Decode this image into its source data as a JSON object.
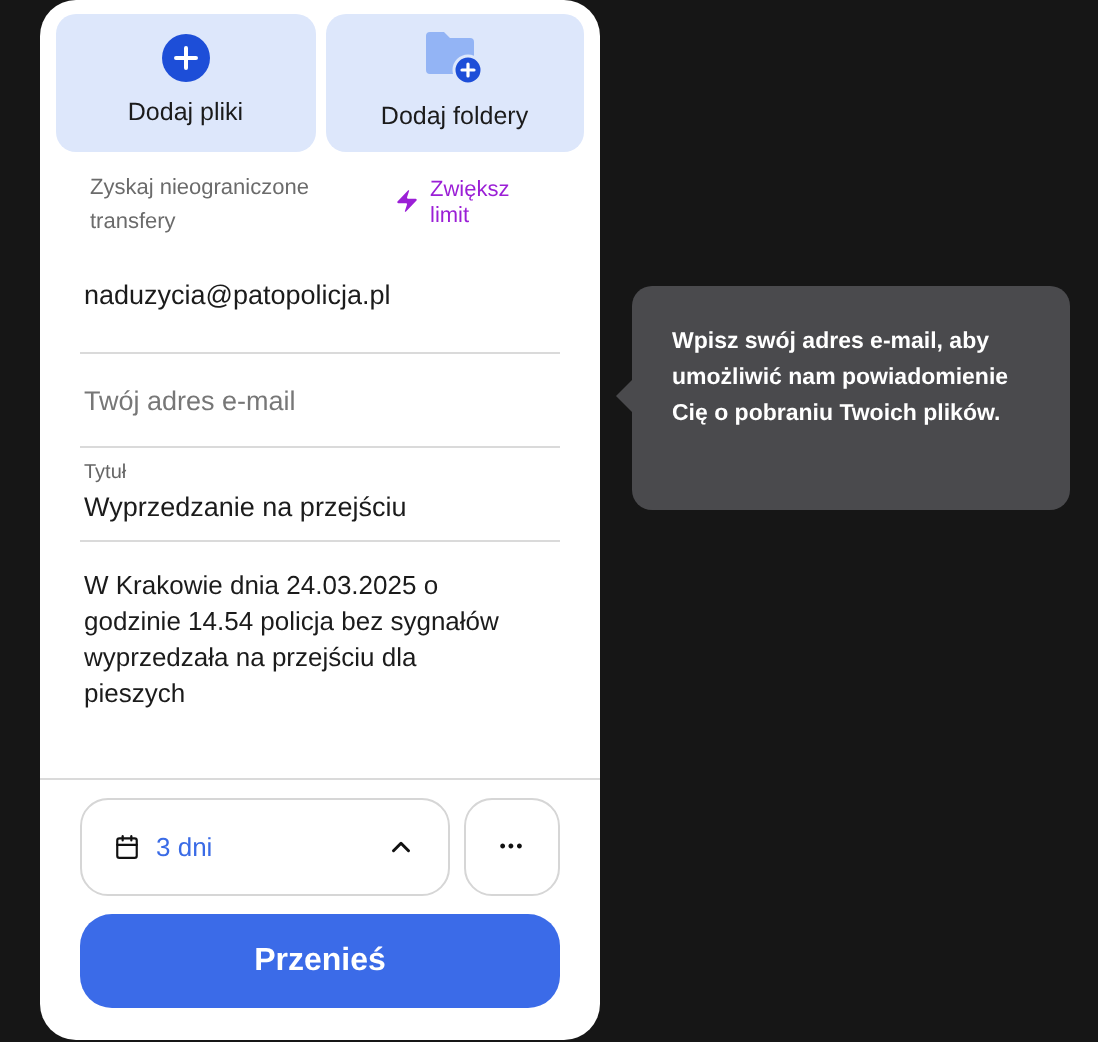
{
  "actions": [
    {
      "kind": "files",
      "label": "Dodaj pliki"
    },
    {
      "kind": "folders",
      "label": "Dodaj foldery"
    }
  ],
  "upsell": {
    "text": "Zyskaj nieograniczone transfery",
    "link": "Zwiększ limit"
  },
  "recipient": {
    "value": "naduzycia@patopolicja.pl"
  },
  "sender": {
    "placeholder": "Twój adres e-mail"
  },
  "title": {
    "label": "Tytuł",
    "value": "Wyprzedzanie na przejściu"
  },
  "message": {
    "value": "W Krakowie dnia 24.03.2025 o godzinie 14.54 policja bez sygnałów wyprzedzała na przejściu dla pieszych"
  },
  "expiry": {
    "value": "3 dni",
    "expanded": false
  },
  "more": {
    "label": "•••"
  },
  "submit": {
    "label": "Przenieś"
  },
  "tooltip": {
    "text": "Wpisz swój adres e-mail, aby umożliwić nam powiadomienie Cię o pobraniu Twoich plików."
  }
}
